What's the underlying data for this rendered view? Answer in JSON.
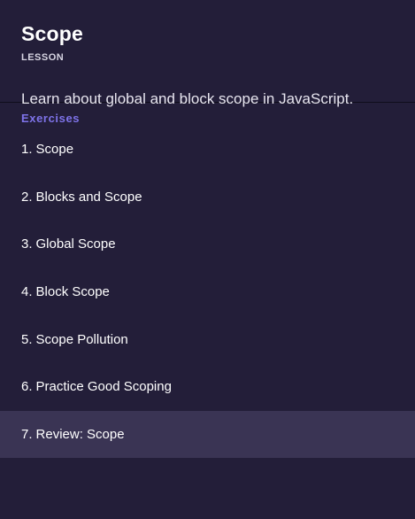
{
  "lesson": {
    "title": "Scope",
    "type_label": "LESSON",
    "description": "Learn about global and block scope in JavaScript."
  },
  "exercises": {
    "label": "Exercises",
    "items": [
      {
        "number": "1.",
        "label": "Scope"
      },
      {
        "number": "2.",
        "label": "Blocks and Scope"
      },
      {
        "number": "3.",
        "label": "Global Scope"
      },
      {
        "number": "4.",
        "label": "Block Scope"
      },
      {
        "number": "5.",
        "label": "Scope Pollution"
      },
      {
        "number": "6.",
        "label": "Practice Good Scoping"
      },
      {
        "number": "7.",
        "label": "Review: Scope",
        "active": true
      }
    ]
  },
  "colors": {
    "background": "#231e39",
    "accent": "#7e73e9",
    "active_row": "#3a3454"
  }
}
